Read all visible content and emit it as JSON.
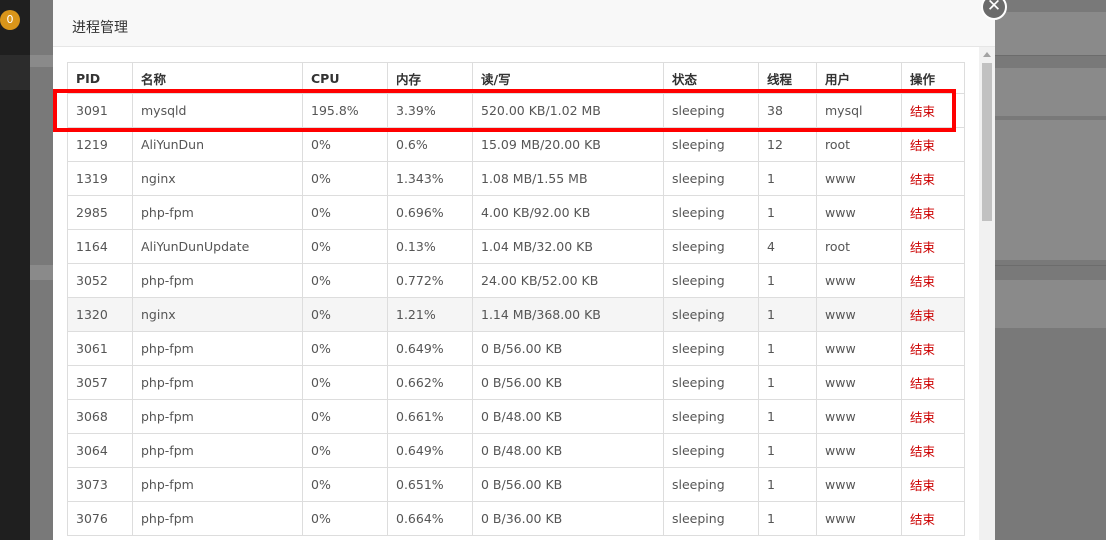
{
  "sidebar": {
    "badge": "0"
  },
  "modal": {
    "title": "进程管理",
    "close_symbol": "✕"
  },
  "table": {
    "headers": [
      "PID",
      "名称",
      "CPU",
      "内存",
      "读/写",
      "状态",
      "线程",
      "用户",
      "操作"
    ],
    "rows": [
      {
        "pid": "3091",
        "name": "mysqld",
        "cpu": "195.8%",
        "mem": "3.39%",
        "io": "520.00 KB/1.02 MB",
        "state": "sleeping",
        "threads": "38",
        "user": "mysql",
        "action": "结束"
      },
      {
        "pid": "1219",
        "name": "AliYunDun",
        "cpu": "0%",
        "mem": "0.6%",
        "io": "15.09 MB/20.00 KB",
        "state": "sleeping",
        "threads": "12",
        "user": "root",
        "action": "结束"
      },
      {
        "pid": "1319",
        "name": "nginx",
        "cpu": "0%",
        "mem": "1.343%",
        "io": "1.08 MB/1.55 MB",
        "state": "sleeping",
        "threads": "1",
        "user": "www",
        "action": "结束"
      },
      {
        "pid": "2985",
        "name": "php-fpm",
        "cpu": "0%",
        "mem": "0.696%",
        "io": "4.00 KB/92.00 KB",
        "state": "sleeping",
        "threads": "1",
        "user": "www",
        "action": "结束"
      },
      {
        "pid": "1164",
        "name": "AliYunDunUpdate",
        "cpu": "0%",
        "mem": "0.13%",
        "io": "1.04 MB/32.00 KB",
        "state": "sleeping",
        "threads": "4",
        "user": "root",
        "action": "结束"
      },
      {
        "pid": "3052",
        "name": "php-fpm",
        "cpu": "0%",
        "mem": "0.772%",
        "io": "24.00 KB/52.00 KB",
        "state": "sleeping",
        "threads": "1",
        "user": "www",
        "action": "结束"
      },
      {
        "pid": "1320",
        "name": "nginx",
        "cpu": "0%",
        "mem": "1.21%",
        "io": "1.14 MB/368.00 KB",
        "state": "sleeping",
        "threads": "1",
        "user": "www",
        "action": "结束"
      },
      {
        "pid": "3061",
        "name": "php-fpm",
        "cpu": "0%",
        "mem": "0.649%",
        "io": "0 B/56.00 KB",
        "state": "sleeping",
        "threads": "1",
        "user": "www",
        "action": "结束"
      },
      {
        "pid": "3057",
        "name": "php-fpm",
        "cpu": "0%",
        "mem": "0.662%",
        "io": "0 B/56.00 KB",
        "state": "sleeping",
        "threads": "1",
        "user": "www",
        "action": "结束"
      },
      {
        "pid": "3068",
        "name": "php-fpm",
        "cpu": "0%",
        "mem": "0.661%",
        "io": "0 B/48.00 KB",
        "state": "sleeping",
        "threads": "1",
        "user": "www",
        "action": "结束"
      },
      {
        "pid": "3064",
        "name": "php-fpm",
        "cpu": "0%",
        "mem": "0.649%",
        "io": "0 B/48.00 KB",
        "state": "sleeping",
        "threads": "1",
        "user": "www",
        "action": "结束"
      },
      {
        "pid": "3073",
        "name": "php-fpm",
        "cpu": "0%",
        "mem": "0.651%",
        "io": "0 B/56.00 KB",
        "state": "sleeping",
        "threads": "1",
        "user": "www",
        "action": "结束"
      },
      {
        "pid": "3076",
        "name": "php-fpm",
        "cpu": "0%",
        "mem": "0.664%",
        "io": "0 B/36.00 KB",
        "state": "sleeping",
        "threads": "1",
        "user": "www",
        "action": "结束"
      }
    ]
  },
  "colors": {
    "action": "#cc0000",
    "highlight_border": "#ff0000",
    "badge": "#d9951a"
  }
}
